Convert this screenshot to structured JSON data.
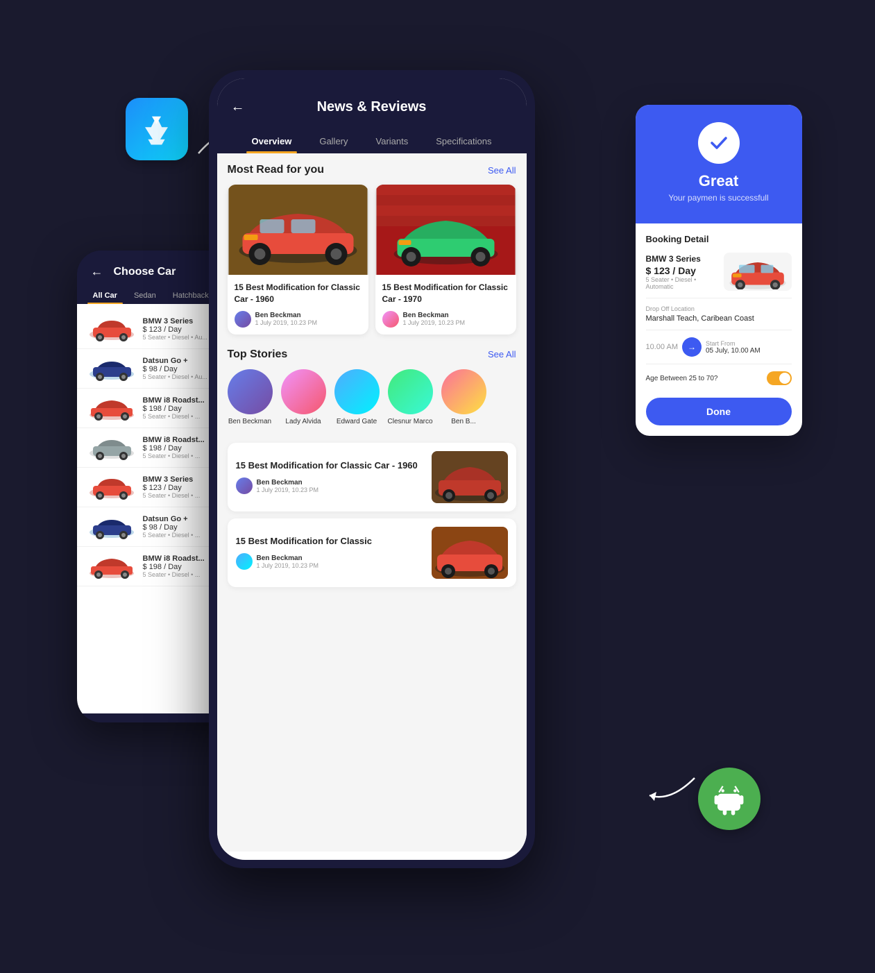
{
  "scene": {
    "background": "#1a1a2e"
  },
  "appstore": {
    "alt": "App Store Icon"
  },
  "android": {
    "alt": "Android Icon"
  },
  "left_phone": {
    "title": "Choose Car",
    "back_label": "←",
    "tabs": [
      {
        "label": "All Car",
        "active": true
      },
      {
        "label": "Sedan",
        "active": false
      },
      {
        "label": "Hatchback",
        "active": false
      }
    ],
    "cars": [
      {
        "name": "BMW 3 Series",
        "price": "$ 123 / Day",
        "specs": "5 Seater  •  Diesel  •  Au..."
      },
      {
        "name": "Datsun Go +",
        "price": "$ 98 / Day",
        "specs": "5 Seater  •  Diesel  •  Au..."
      },
      {
        "name": "BMW i8 Roadst...",
        "price": "$ 198 / Day",
        "specs": "5 Seater  •  Diesel  •  ..."
      },
      {
        "name": "BMW i8 Roadst...",
        "price": "$ 198 / Day",
        "specs": "5 Seater  •  Diesel  •  ..."
      },
      {
        "name": "BMW 3 Series",
        "price": "$ 123 / Day",
        "specs": "5 Seater  •  Diesel  •  ..."
      },
      {
        "name": "Datsun Go +",
        "price": "$ 98 / Day",
        "specs": "5 Seater  •  Diesel  •  ..."
      },
      {
        "name": "BMW i8 Roadst...",
        "price": "$ 198 / Day",
        "specs": "5 Seater  •  Diesel  •  ..."
      }
    ]
  },
  "main_phone": {
    "header": {
      "back_label": "←",
      "title": "News & Reviews"
    },
    "tabs": [
      {
        "label": "Overview",
        "active": true
      },
      {
        "label": "Gallery",
        "active": false
      },
      {
        "label": "Variants",
        "active": false
      },
      {
        "label": "Specifications",
        "active": false
      }
    ],
    "most_read": {
      "section_title": "Most Read for you",
      "see_all": "See All",
      "articles": [
        {
          "title": "15 Best Modification for Classic Car - 1960",
          "author": "Ben Beckman",
          "date": "1 July 2019, 10.23 PM"
        },
        {
          "title": "15 Best Modification for Classic Car - 1970",
          "author": "Ben Beckman",
          "date": "1 July 2019, 10.23 PM"
        }
      ]
    },
    "top_stories": {
      "section_title": "Top Stories",
      "see_all": "See All",
      "people": [
        {
          "name": "Ben Beckman"
        },
        {
          "name": "Lady Alvida"
        },
        {
          "name": "Edward Gate"
        },
        {
          "name": "Clesnur Marco"
        },
        {
          "name": "Ben B..."
        }
      ]
    },
    "bottom_articles": [
      {
        "title": "15 Best Modification for Classic Car - 1960",
        "author": "Ben Beckman",
        "date": "1 July 2019, 10.23 PM"
      },
      {
        "title": "15 Best Modification for Classic",
        "author": "Ben Beckman",
        "date": "1 July 2019, 10.23 PM"
      }
    ]
  },
  "right_card": {
    "top": {
      "check_icon": "✓",
      "title": "Great",
      "subtitle": "Your paymen is successfull"
    },
    "booking_detail": {
      "title": "Booking Detail",
      "car_name": "BMW 3 Series",
      "car_price": "$ 123 / Day",
      "car_specs": "5 Seater  •  Diesel  •  Automatic",
      "drop_off_label": "Drop Off Location",
      "drop_off_value": "Marshall Teach, Caribean Coast",
      "time_from": "10.00 AM",
      "arrow": "→",
      "time_label": "Start From",
      "time_value": "05 July, 10.00 AM",
      "age_label": "Age Between 25 to 70?",
      "done_button": "Done"
    }
  }
}
